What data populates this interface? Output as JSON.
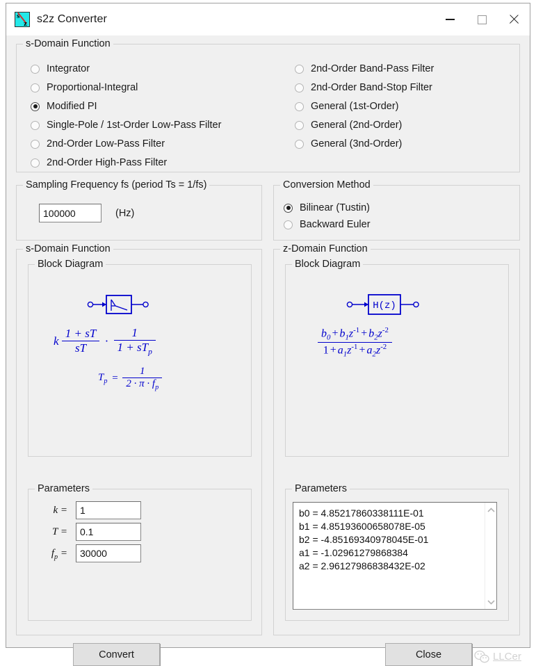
{
  "window": {
    "title": "s2z Converter",
    "icon_name": "s2z-app-icon",
    "controls": {
      "minimize": "Minimize",
      "maximize": "Maximize",
      "close": "Close"
    }
  },
  "s_domain_function_group": {
    "legend": "s-Domain Function",
    "options_left": [
      {
        "label": "Integrator",
        "checked": false
      },
      {
        "label": "Proportional-Integral",
        "checked": false
      },
      {
        "label": "Modified PI",
        "checked": true
      },
      {
        "label": "Single-Pole / 1st-Order Low-Pass Filter",
        "checked": false
      },
      {
        "label": "2nd-Order Low-Pass Filter",
        "checked": false
      },
      {
        "label": "2nd-Order High-Pass Filter",
        "checked": false
      }
    ],
    "options_right": [
      {
        "label": "2nd-Order Band-Pass Filter",
        "checked": false
      },
      {
        "label": "2nd-Order Band-Stop Filter",
        "checked": false
      },
      {
        "label": "General (1st-Order)",
        "checked": false
      },
      {
        "label": "General (2nd-Order)",
        "checked": false
      },
      {
        "label": "General (3nd-Order)",
        "checked": false
      }
    ]
  },
  "sampling": {
    "legend": "Sampling Frequency fs (period Ts = 1/fs)",
    "value": "100000",
    "unit": "(Hz)"
  },
  "conversion_method": {
    "legend": "Conversion Method",
    "options": [
      {
        "label": "Bilinear (Tustin)",
        "checked": true
      },
      {
        "label": "Backward Euler",
        "checked": false
      }
    ]
  },
  "s_panel": {
    "legend": "s-Domain Function",
    "block_diagram_legend": "Block Diagram",
    "diagram_icon": "transfer-block-step-response",
    "formula": {
      "gain": "k",
      "frac1_num": "1 + sT",
      "frac1_den": "sT",
      "dot": "·",
      "frac2_num": "1",
      "frac2_den": "1 + sT",
      "frac2_den_sub": "p",
      "tp_lhs": "T",
      "tp_lhs_sub": "p",
      "tp_eq": "=",
      "tp_num": "1",
      "tp_den": "2 · π · f",
      "tp_den_sub": "p"
    },
    "parameters_legend": "Parameters",
    "parameters": [
      {
        "name": "k",
        "sub": "",
        "value": "1"
      },
      {
        "name": "T",
        "sub": "",
        "value": "0.1"
      },
      {
        "name": "f",
        "sub": "p",
        "value": "30000"
      }
    ]
  },
  "z_panel": {
    "legend": "z-Domain Function",
    "block_diagram_legend": "Block Diagram",
    "diagram_icon": "transfer-block-hz",
    "block_label": "H(z)",
    "formula": {
      "num_b0": "b",
      "num_b0_sub": "0",
      "plus": "+",
      "num_b1": "b",
      "num_b1_sub": "1",
      "z_inv1": "z",
      "z_inv1_sup": "-1",
      "num_b2": "b",
      "num_b2_sub": "2",
      "z_inv2": "z",
      "z_inv2_sup": "-2",
      "den_one": "1",
      "den_a1": "a",
      "den_a1_sub": "1",
      "den_a2": "a",
      "den_a2_sub": "2"
    },
    "parameters_legend": "Parameters",
    "results": [
      "b0 = 4.85217860338111E-01",
      "b1 = 4.85193600658078E-05",
      "b2 = -4.85169340978045E-01",
      "a1 = -1.02961279868384",
      "a2 = 2.96127986838432E-02"
    ],
    "scrollbar": {
      "up_icon": "chevron-up-icon",
      "down_icon": "chevron-down-icon"
    }
  },
  "footer": {
    "convert_label": "Convert",
    "close_label": "Close",
    "watermark_text": "LLCer",
    "watermark_icon": "wechat-icon"
  },
  "colors": {
    "panel_bg": "#f0f0f0",
    "diagram_blue": "#0000cc",
    "icon_cyan": "#25e8e8",
    "text": "#1a1a1a"
  }
}
